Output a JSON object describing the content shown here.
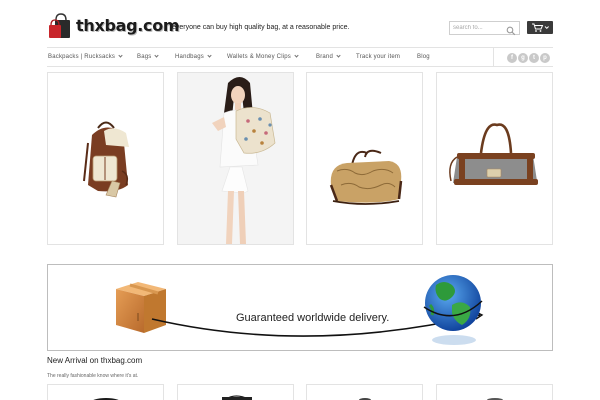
{
  "header": {
    "logo_text": "thxbag.com",
    "tagline": "everyone can buy high quality bag, at a reasonable price.",
    "search": {
      "placeholder": "search fo..."
    },
    "icons": {
      "logo": "shopping-bags-icon",
      "search": "search-icon",
      "cart": "cart-icon"
    }
  },
  "nav": {
    "items": [
      {
        "label": "Backpacks | Rucksacks",
        "dropdown": true
      },
      {
        "label": "Bags",
        "dropdown": true
      },
      {
        "label": "Handbags",
        "dropdown": true
      },
      {
        "label": "Wallets & Money Clips",
        "dropdown": true
      },
      {
        "label": "Brand",
        "dropdown": true
      },
      {
        "label": "Track your item",
        "dropdown": false
      },
      {
        "label": "Blog",
        "dropdown": false
      }
    ],
    "social": [
      {
        "icon": "facebook-icon",
        "glyph": "f"
      },
      {
        "icon": "google-plus-icon",
        "glyph": "g"
      },
      {
        "icon": "twitter-icon",
        "glyph": "t"
      },
      {
        "icon": "pinterest-icon",
        "glyph": "p"
      }
    ]
  },
  "products": [
    {
      "image": "brown-leather-backpack"
    },
    {
      "image": "woman-with-floral-backpack"
    },
    {
      "image": "map-print-duffel-bag"
    },
    {
      "image": "grey-canvas-duffel-bag"
    }
  ],
  "banner": {
    "text": "Guaranteed worldwide delivery.",
    "icons": {
      "box": "shipping-box-icon",
      "globe": "globe-icon"
    }
  },
  "new_arrival": {
    "title": "New Arrival on thxbag.com",
    "subtitle": "The really fashionable know where it's at."
  },
  "colors": {
    "brand_red": "#c8262b",
    "dark": "#3a3a3a",
    "border": "#e3e3e3"
  }
}
